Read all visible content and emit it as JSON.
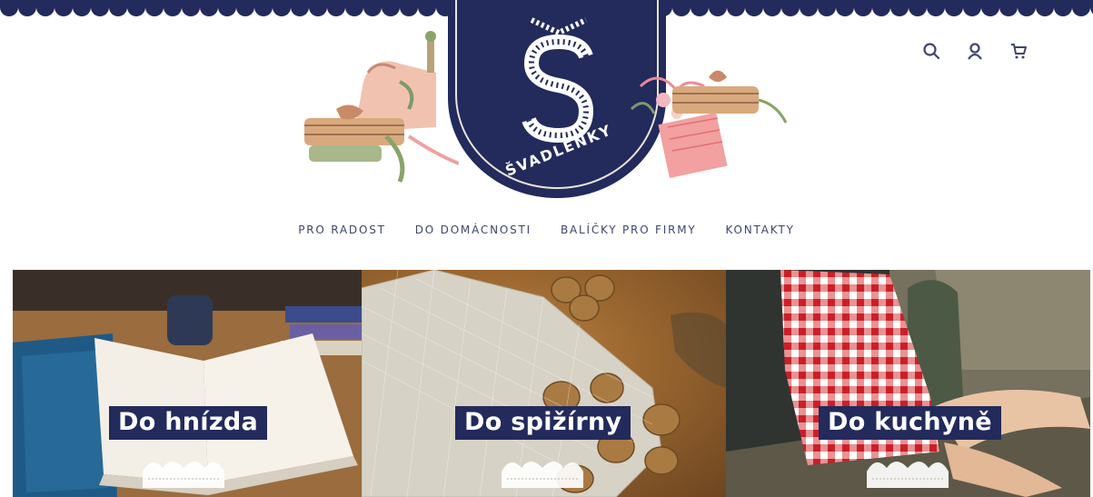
{
  "brand": {
    "name": "ŠVADLENKY",
    "navy": "#232a5c"
  },
  "header_icons": [
    {
      "name": "search-icon"
    },
    {
      "name": "user-icon"
    },
    {
      "name": "cart-icon"
    }
  ],
  "nav": {
    "items": [
      {
        "label": "PRO RADOST"
      },
      {
        "label": "DO DOMÁCNOSTI"
      },
      {
        "label": "BALÍČKY PRO FIRMY"
      },
      {
        "label": "KONTAKTY"
      }
    ]
  },
  "tiles": [
    {
      "label": "Do hnízda",
      "image": "open book on table with blue fabric and mug"
    },
    {
      "label": "Do spižírny",
      "image": "mesh bag with walnuts"
    },
    {
      "label": "Do kuchyně",
      "image": "red gingham cloth with green jug"
    }
  ]
}
